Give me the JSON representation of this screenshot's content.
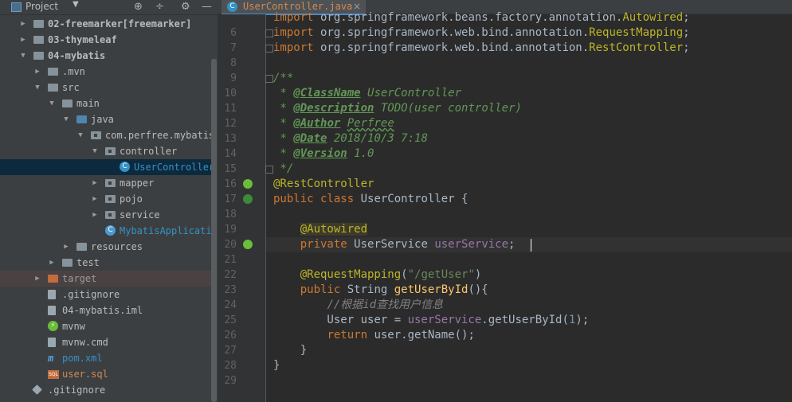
{
  "project": {
    "title": "Project",
    "toolbar": [
      "⊕",
      "÷",
      "⚙",
      "—"
    ],
    "tree": [
      {
        "label": "02-freemarker",
        "suffix": " [freemarker]",
        "type": "module",
        "depth": 1,
        "open": false
      },
      {
        "label": "03-thymeleaf",
        "type": "module",
        "depth": 1,
        "open": false
      },
      {
        "label": "04-mybatis",
        "type": "module",
        "depth": 1,
        "open": true
      },
      {
        "label": ".mvn",
        "type": "folder",
        "depth": 2,
        "open": false
      },
      {
        "label": "src",
        "type": "folder",
        "depth": 2,
        "open": true
      },
      {
        "label": "main",
        "type": "folder",
        "depth": 3,
        "open": true
      },
      {
        "label": "java",
        "type": "src",
        "depth": 4,
        "open": true
      },
      {
        "label": "com.perfree.mybatis",
        "type": "pkg",
        "depth": 5,
        "open": true
      },
      {
        "label": "controller",
        "type": "pkg",
        "depth": 6,
        "open": true
      },
      {
        "label": "UserController",
        "type": "class",
        "depth": 7,
        "selected": true
      },
      {
        "label": "mapper",
        "type": "pkg",
        "depth": 6,
        "open": false
      },
      {
        "label": "pojo",
        "type": "pkg",
        "depth": 6,
        "open": false
      },
      {
        "label": "service",
        "type": "pkg",
        "depth": 6,
        "open": false
      },
      {
        "label": "MybatisApplication",
        "type": "spring",
        "depth": 6
      },
      {
        "label": "resources",
        "type": "folder",
        "depth": 4,
        "open": false
      },
      {
        "label": "test",
        "type": "folder",
        "depth": 3,
        "open": false
      },
      {
        "label": "target",
        "type": "orange",
        "depth": 2,
        "open": false
      },
      {
        "label": ".gitignore",
        "type": "file",
        "depth": 2
      },
      {
        "label": "04-mybatis.iml",
        "type": "file",
        "depth": 2
      },
      {
        "label": "mvnw",
        "type": "mvnw",
        "depth": 2
      },
      {
        "label": "mvnw.cmd",
        "type": "file",
        "depth": 2
      },
      {
        "label": "pom.xml",
        "type": "maven",
        "depth": 2
      },
      {
        "label": "user.sql",
        "type": "sql",
        "depth": 2
      },
      {
        "label": ".gitignore",
        "type": "git",
        "depth": 1
      }
    ]
  },
  "editor": {
    "tab": {
      "label": "UserController.java",
      "close": "×"
    },
    "lines": [
      {
        "n": "",
        "html": "<span class='kw'>import</span> org.springframework.beans.factory.annotation.<span class='impcls'>Autowired</span>;"
      },
      {
        "n": "6",
        "html": "<span class='kw'>import</span> org.springframework.web.bind.annotation.<span class='impcls'>RequestMapping</span>;"
      },
      {
        "n": "7",
        "html": "<span class='kw'>import</span> org.springframework.web.bind.annotation.<span class='impcls'>RestController</span>;"
      },
      {
        "n": "8",
        "html": ""
      },
      {
        "n": "9",
        "html": "<span class='dstar'>/**</span>"
      },
      {
        "n": "10",
        "html": "<span class='dstar'> * </span><span class='dtag'>@ClassName</span><span class='dtxt'> UserController</span>"
      },
      {
        "n": "11",
        "html": "<span class='dstar'> * </span><span class='dtag'>@Description</span><span class='dtxt'> TODO(user controller)</span>"
      },
      {
        "n": "12",
        "html": "<span class='dstar'> * </span><span class='dtag'>@Author</span><span class='dtxt'> </span><span class='dq'>Perfree</span>"
      },
      {
        "n": "13",
        "html": "<span class='dstar'> * </span><span class='dtag'>@Date</span><span class='dtxt'> 2018/10/3 7:18</span>"
      },
      {
        "n": "14",
        "html": "<span class='dstar'> * </span><span class='dtag'>@Version</span><span class='dtxt'> 1.0</span>"
      },
      {
        "n": "15",
        "html": "<span class='dstar'> */</span>"
      },
      {
        "n": "16",
        "html": "<span class='ann'>@RestController</span>"
      },
      {
        "n": "17",
        "html": "<span class='kw'>public class</span> UserController {"
      },
      {
        "n": "18",
        "html": ""
      },
      {
        "n": "19",
        "html": "    <span class='anb'>@Autowired</span>"
      },
      {
        "n": "20",
        "html": "    <span class='kw'>private</span> UserService <span class='fld'>userService</span>;"
      },
      {
        "n": "21",
        "html": ""
      },
      {
        "n": "22",
        "html": "    <span class='ann'>@RequestMapping</span>(<span class='str'>\"/getUser\"</span>)"
      },
      {
        "n": "23",
        "html": "    <span class='kw'>public</span> String <span class='meth'>getUserById</span>(){"
      },
      {
        "n": "24",
        "html": "        <span class='cmt'>//根据id查找用户信息</span>"
      },
      {
        "n": "25",
        "html": "        User user = <span class='fld'>userService</span>.getUserById(<span class='num'>1</span>);"
      },
      {
        "n": "26",
        "html": "        <span class='kw'>return</span> user.getName();"
      },
      {
        "n": "27",
        "html": "    }"
      },
      {
        "n": "28",
        "html": "}"
      },
      {
        "n": "29",
        "html": ""
      }
    ]
  }
}
